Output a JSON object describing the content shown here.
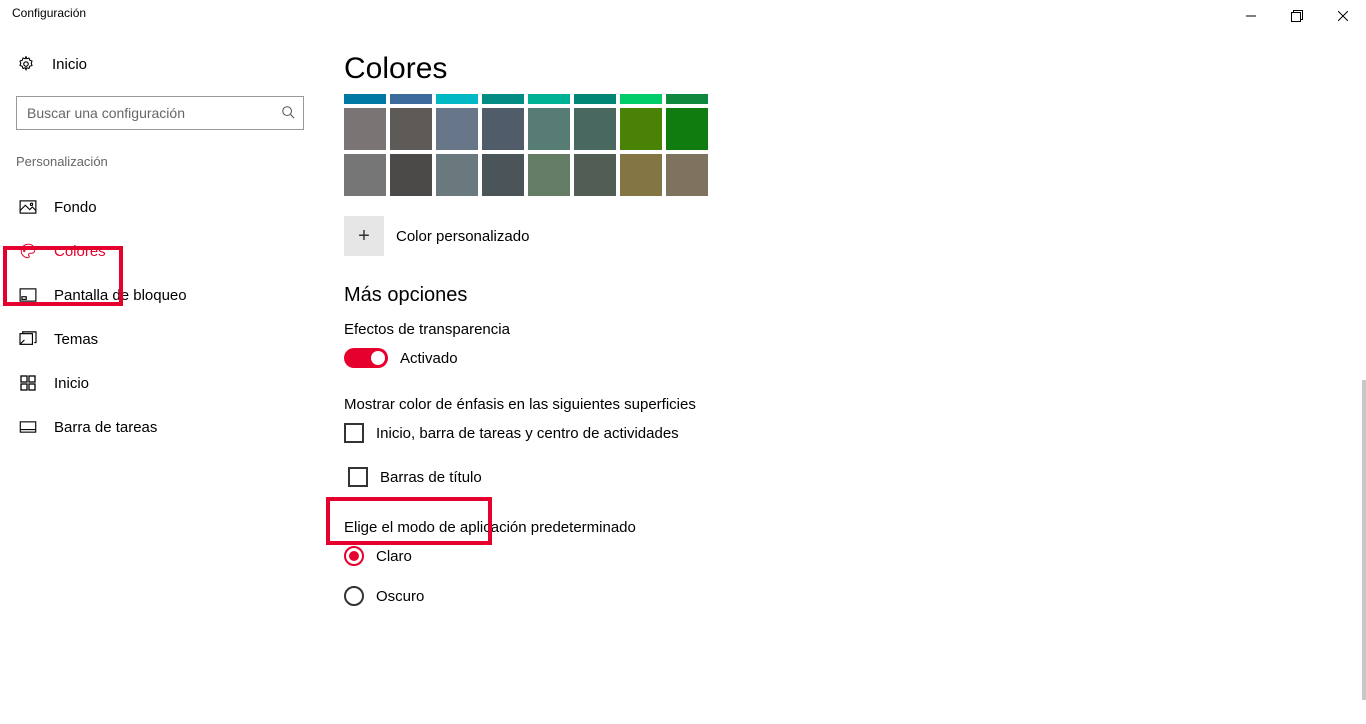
{
  "window": {
    "title": "Configuración"
  },
  "sidebar": {
    "home": "Inicio",
    "search_placeholder": "Buscar una configuración",
    "section": "Personalización",
    "items": [
      {
        "label": "Fondo"
      },
      {
        "label": "Colores"
      },
      {
        "label": "Pantalla de bloqueo"
      },
      {
        "label": "Temas"
      },
      {
        "label": "Inicio"
      },
      {
        "label": "Barra de tareas"
      }
    ]
  },
  "main": {
    "heading": "Colores",
    "color_strip": [
      "#0078A4",
      "#3C6C9C",
      "#00B9C4",
      "#038C84",
      "#00B294",
      "#018574",
      "#00CC6A",
      "#10893E"
    ],
    "color_rows": [
      [
        "#7A7574",
        "#5D5A58",
        "#68768A",
        "#515C6B",
        "#567C73",
        "#486860",
        "#498205",
        "#107C10"
      ],
      [
        "#767676",
        "#4C4A48",
        "#69797E",
        "#4A5459",
        "#647C64",
        "#525E54",
        "#847545",
        "#7E735F"
      ]
    ],
    "custom_color_label": "Color personalizado",
    "more_options_heading": "Más opciones",
    "transparency_label": "Efectos de transparencia",
    "transparency_state": "Activado",
    "accent_surfaces_label": "Mostrar color de énfasis en las siguientes superficies",
    "checkbox_start_label": "Inicio, barra de tareas y centro de actividades",
    "checkbox_titlebars_label": "Barras de título",
    "app_mode_heading": "Elige el modo de aplicación predeterminado",
    "mode_light": "Claro",
    "mode_dark": "Oscuro"
  }
}
